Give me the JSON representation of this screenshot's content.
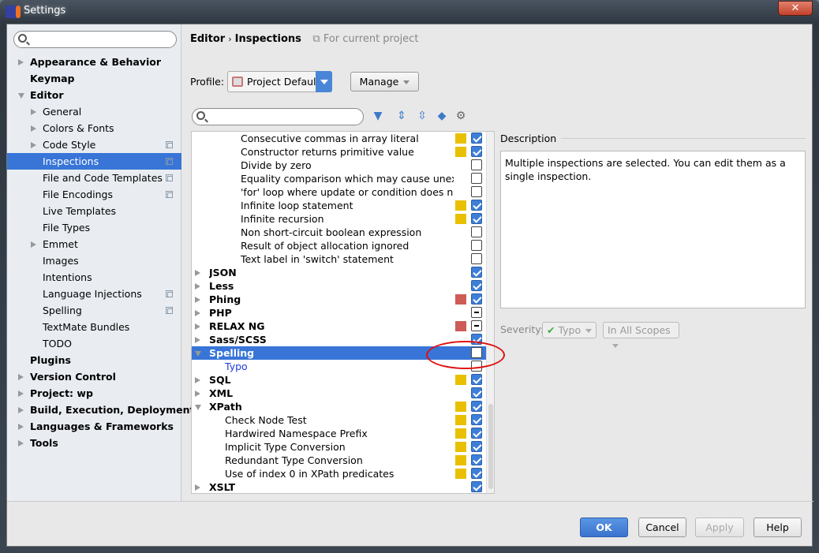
{
  "window": {
    "title": "Settings",
    "close": "✕"
  },
  "sidebar": {
    "search_placeholder": "",
    "items": [
      {
        "label": "Appearance & Behavior",
        "level": 0,
        "arrow": "right",
        "bold": true
      },
      {
        "label": "Keymap",
        "level": 0,
        "arrow": "none",
        "bold": true
      },
      {
        "label": "Editor",
        "level": 0,
        "arrow": "down",
        "bold": true
      },
      {
        "label": "General",
        "level": 1,
        "arrow": "right"
      },
      {
        "label": "Colors & Fonts",
        "level": 1,
        "arrow": "right"
      },
      {
        "label": "Code Style",
        "level": 1,
        "arrow": "right",
        "project": true
      },
      {
        "label": "Inspections",
        "level": 1,
        "arrow": "none",
        "project": true,
        "selected": true
      },
      {
        "label": "File and Code Templates",
        "level": 1,
        "arrow": "none",
        "project": true
      },
      {
        "label": "File Encodings",
        "level": 1,
        "arrow": "none",
        "project": true
      },
      {
        "label": "Live Templates",
        "level": 1,
        "arrow": "none"
      },
      {
        "label": "File Types",
        "level": 1,
        "arrow": "none"
      },
      {
        "label": "Emmet",
        "level": 1,
        "arrow": "right"
      },
      {
        "label": "Images",
        "level": 1,
        "arrow": "none"
      },
      {
        "label": "Intentions",
        "level": 1,
        "arrow": "none"
      },
      {
        "label": "Language Injections",
        "level": 1,
        "arrow": "none",
        "project": true
      },
      {
        "label": "Spelling",
        "level": 1,
        "arrow": "none",
        "project": true
      },
      {
        "label": "TextMate Bundles",
        "level": 1,
        "arrow": "none"
      },
      {
        "label": "TODO",
        "level": 1,
        "arrow": "none"
      },
      {
        "label": "Plugins",
        "level": 0,
        "arrow": "none",
        "bold": true
      },
      {
        "label": "Version Control",
        "level": 0,
        "arrow": "right",
        "bold": true
      },
      {
        "label": "Project: wp",
        "level": 0,
        "arrow": "right",
        "bold": true
      },
      {
        "label": "Build, Execution, Deployment",
        "level": 0,
        "arrow": "right",
        "bold": true
      },
      {
        "label": "Languages & Frameworks",
        "level": 0,
        "arrow": "right",
        "bold": true
      },
      {
        "label": "Tools",
        "level": 0,
        "arrow": "right",
        "bold": true
      }
    ]
  },
  "header": {
    "breadcrumb_parent": "Editor",
    "breadcrumb_sep": "›",
    "breadcrumb_current": "Inspections",
    "scope_note": "For current project"
  },
  "profile": {
    "label": "Profile:",
    "value": "Project Default",
    "manage": "Manage"
  },
  "toolbar": {
    "icons": [
      "filter-icon",
      "expand-all-icon",
      "collapse-all-icon",
      "reset-icon",
      "settings-gear-icon"
    ]
  },
  "colors": {
    "warning": "#e8c000",
    "error": "#cd5c57",
    "selection": "#3875d7",
    "checkbox": "#3d7fd8"
  },
  "tree": [
    {
      "label": "Consecutive commas in array literal",
      "level": 2,
      "severity": "warning",
      "check": "on"
    },
    {
      "label": "Constructor returns primitive value",
      "level": 2,
      "severity": "warning",
      "check": "on"
    },
    {
      "label": "Divide by zero",
      "level": 2,
      "check": "off"
    },
    {
      "label": "Equality comparison which may cause unexpected type coercion",
      "level": 2,
      "check": "off"
    },
    {
      "label": "'for' loop where update or condition does not use loop variable",
      "level": 2,
      "check": "off"
    },
    {
      "label": "Infinite loop statement",
      "level": 2,
      "severity": "warning",
      "check": "on"
    },
    {
      "label": "Infinite recursion",
      "level": 2,
      "severity": "warning",
      "check": "on"
    },
    {
      "label": "Non short-circuit boolean expression",
      "level": 2,
      "check": "off"
    },
    {
      "label": "Result of object allocation ignored",
      "level": 2,
      "check": "off"
    },
    {
      "label": "Text label in 'switch' statement",
      "level": 2,
      "check": "off"
    },
    {
      "label": "JSON",
      "level": 0,
      "arrow": "right",
      "bold": true,
      "check": "on"
    },
    {
      "label": "Less",
      "level": 0,
      "arrow": "right",
      "bold": true,
      "check": "on"
    },
    {
      "label": "Phing",
      "level": 0,
      "arrow": "right",
      "bold": true,
      "severity": "error",
      "check": "on"
    },
    {
      "label": "PHP",
      "level": 0,
      "arrow": "right",
      "bold": true,
      "check": "mixed"
    },
    {
      "label": "RELAX NG",
      "level": 0,
      "arrow": "right",
      "bold": true,
      "severity": "error",
      "check": "mixed"
    },
    {
      "label": "Sass/SCSS",
      "level": 0,
      "arrow": "right",
      "bold": true,
      "check": "on"
    },
    {
      "label": "Spelling",
      "level": 0,
      "arrow": "down",
      "bold": true,
      "check": "off",
      "selected": true
    },
    {
      "label": "Typo",
      "level": 1,
      "check": "off",
      "link": true
    },
    {
      "label": "SQL",
      "level": 0,
      "arrow": "right",
      "bold": true,
      "severity": "warning",
      "check": "on"
    },
    {
      "label": "XML",
      "level": 0,
      "arrow": "right",
      "bold": true,
      "check": "on"
    },
    {
      "label": "XPath",
      "level": 0,
      "arrow": "down",
      "bold": true,
      "severity": "warning",
      "check": "on"
    },
    {
      "label": "Check Node Test",
      "level": 1,
      "severity": "warning",
      "check": "on"
    },
    {
      "label": "Hardwired Namespace Prefix",
      "level": 1,
      "severity": "warning",
      "check": "on"
    },
    {
      "label": "Implicit Type Conversion",
      "level": 1,
      "severity": "warning",
      "check": "on"
    },
    {
      "label": "Redundant Type Conversion",
      "level": 1,
      "severity": "warning",
      "check": "on"
    },
    {
      "label": "Use of index 0 in XPath predicates",
      "level": 1,
      "severity": "warning",
      "check": "on"
    },
    {
      "label": "XSLT",
      "level": 0,
      "arrow": "right",
      "bold": true,
      "check": "on"
    }
  ],
  "description": {
    "label": "Description",
    "text": "Multiple inspections are selected. You can edit them as a single inspection."
  },
  "severity": {
    "label": "Severity:",
    "value": "Typo",
    "scope": "In All Scopes"
  },
  "footer": {
    "ok": "OK",
    "cancel": "Cancel",
    "apply": "Apply",
    "help": "Help"
  }
}
